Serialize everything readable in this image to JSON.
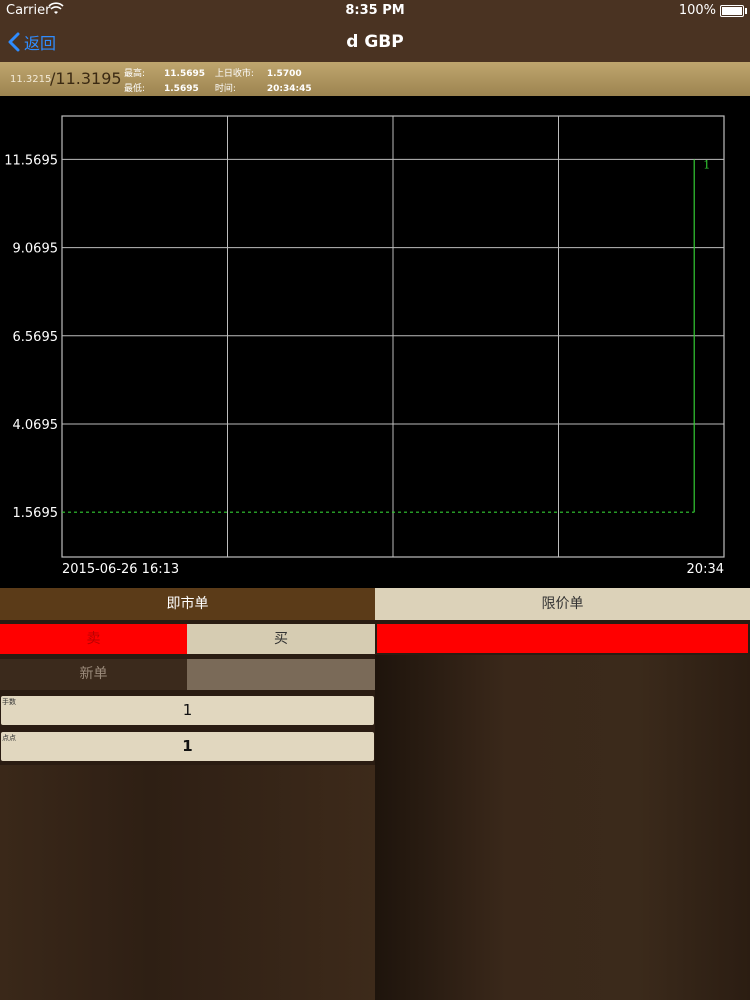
{
  "status_bar": {
    "carrier": "Carrier",
    "time": "8:35 PM",
    "battery": "100%"
  },
  "nav": {
    "back_label": "返回",
    "title": "d GBP"
  },
  "info_bar": {
    "prev_price": "11.3215",
    "current_price": "/11.3195",
    "high_label": "最高:",
    "high_value": "11.5695",
    "prev_close_label": "上日收市:",
    "prev_close_value": "1.5700",
    "low_label": "最低:",
    "low_value": "1.5695",
    "time_label": "时间:",
    "time_value": "20:34:45"
  },
  "chart_data": {
    "type": "line",
    "y_ticks": [
      "11.5695",
      "9.0695",
      "6.5695",
      "4.0695",
      "1.5695"
    ],
    "y_tick_values": [
      11.5695,
      9.0695,
      6.5695,
      4.0695,
      1.5695
    ],
    "x_start_label": "2015-06-26 16:13",
    "x_end_label": "20:34",
    "ylim": [
      0.3,
      12.8
    ],
    "end_marker": "1",
    "grid": true,
    "series": [
      {
        "color": "#33cc33",
        "style": "dashed",
        "points": [
          [
            0,
            1.5695
          ],
          [
            0.955,
            1.5695
          ]
        ]
      },
      {
        "color": "#33cc33",
        "style": "solid",
        "points": [
          [
            0.955,
            1.5695
          ],
          [
            0.955,
            11.5695
          ]
        ]
      }
    ]
  },
  "order": {
    "tab_market": "即市单",
    "tab_limit": "限价单",
    "sell": "卖",
    "buy": "买",
    "new_order": "新单",
    "lots_label": "手数",
    "lots_value": "1",
    "pips_label": "点点",
    "pips_value": "1"
  },
  "colors": {
    "accent": "#2f8cff",
    "sell": "#ff0000",
    "line": "#33cc33"
  }
}
